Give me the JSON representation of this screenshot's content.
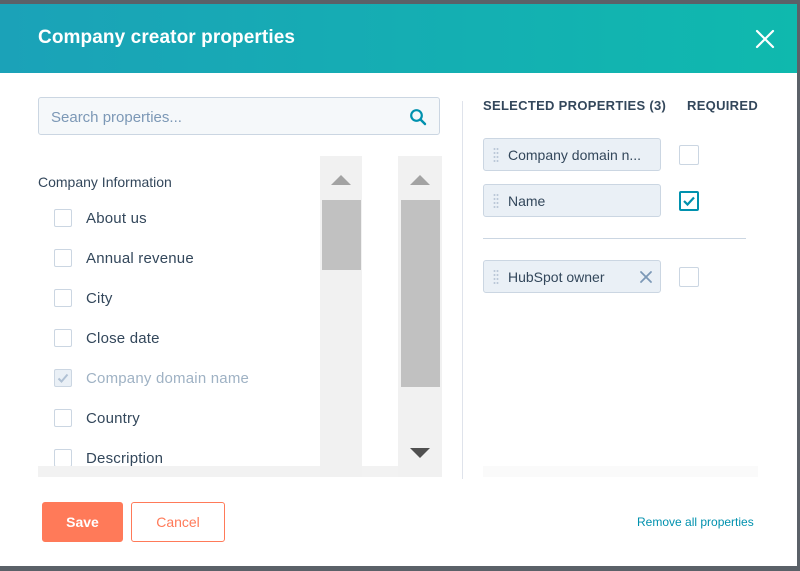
{
  "dialog": {
    "title": "Company creator properties",
    "close_icon": "close-icon"
  },
  "search": {
    "placeholder": "Search properties...",
    "value": "",
    "icon": "search-icon"
  },
  "property_list": {
    "group_label": "Company Information",
    "items": [
      {
        "label": "About us",
        "checked": false,
        "disabled": false
      },
      {
        "label": "Annual revenue",
        "checked": false,
        "disabled": false
      },
      {
        "label": "City",
        "checked": false,
        "disabled": false
      },
      {
        "label": "Close date",
        "checked": false,
        "disabled": false
      },
      {
        "label": "Company domain name",
        "checked": true,
        "disabled": true
      },
      {
        "label": "Country",
        "checked": false,
        "disabled": false
      },
      {
        "label": "Description",
        "checked": false,
        "disabled": false
      }
    ]
  },
  "selected": {
    "header": "SELECTED PROPERTIES (3)",
    "required_header": "REQUIRED",
    "items": [
      {
        "label": "Company domain n...",
        "required": false,
        "removable": false
      },
      {
        "label": "Name",
        "required": true,
        "removable": false
      },
      {
        "label": "HubSpot owner",
        "required": false,
        "removable": true
      }
    ]
  },
  "footer": {
    "save_label": "Save",
    "cancel_label": "Cancel",
    "remove_all_label": "Remove all properties"
  },
  "colors": {
    "header_gradient_start": "#1ba2b8",
    "header_gradient_end": "#0fb9ae",
    "primary_button": "#ff7a59",
    "link": "#0091ae",
    "checkbox_checked_border": "#0091ae"
  }
}
